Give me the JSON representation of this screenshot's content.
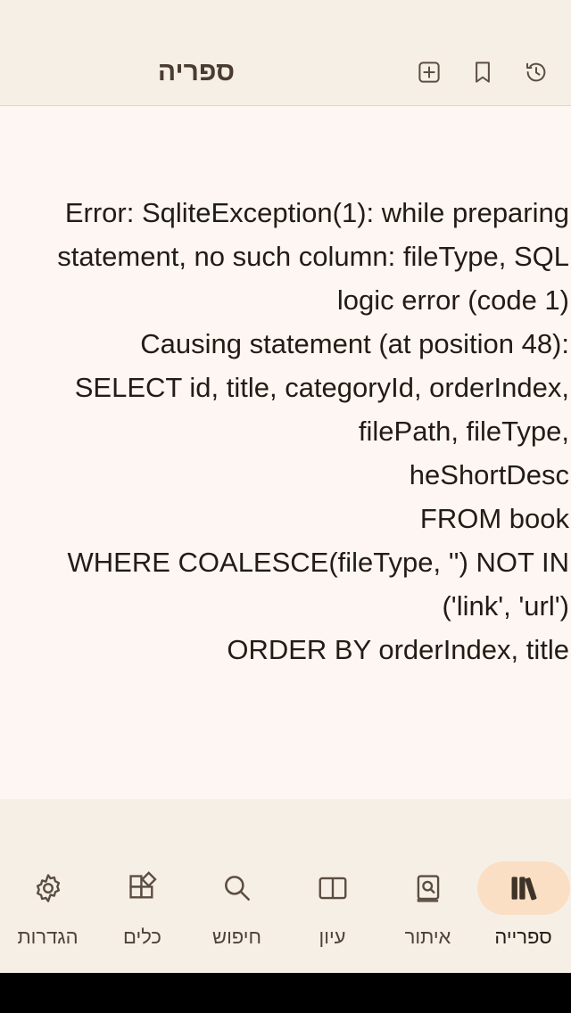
{
  "app_bar": {
    "title": "ספריה",
    "actions": [
      {
        "icon": "add-box-icon"
      },
      {
        "icon": "bookmark-icon"
      },
      {
        "icon": "history-icon"
      }
    ]
  },
  "main": {
    "error_message": "Error: SqliteException(1): while preparing statement, no such column: fileType, SQL logic error (code 1)\n  Causing statement (at position 48):\n  SELECT id, title, categoryId, orderIndex, filePath, fileType,\n        heShortDesc\n        FROM book\n        WHERE COALESCE(fileType, '') NOT IN ('link', 'url')\n        ORDER BY orderIndex, title"
  },
  "bottom_nav": {
    "items": [
      {
        "label": "ספרייה",
        "icon": "library-books-icon",
        "active": true
      },
      {
        "label": "איתור",
        "icon": "find-book-icon",
        "active": false
      },
      {
        "label": "עיון",
        "icon": "open-book-icon",
        "active": false
      },
      {
        "label": "חיפוש",
        "icon": "search-icon",
        "active": false
      },
      {
        "label": "כלים",
        "icon": "tools-icon",
        "active": false
      },
      {
        "label": "הגדרות",
        "icon": "gear-icon",
        "active": false
      }
    ]
  },
  "colors": {
    "bar_background": "#f6efe6",
    "page_background": "#fdf6f2",
    "active_pill": "#fadfc4",
    "title_text": "#4a3c2e",
    "body_text": "#231c16"
  }
}
